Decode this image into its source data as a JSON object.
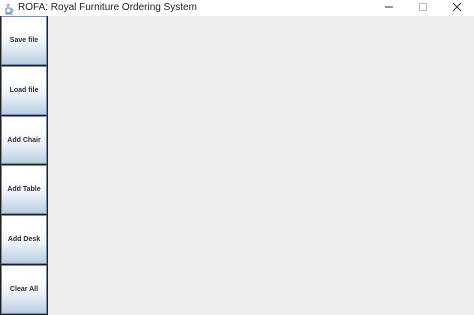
{
  "window": {
    "title": "ROFA: Royal Furniture Ordering System"
  },
  "toolbar": {
    "buttons": [
      {
        "label": "Save file"
      },
      {
        "label": "Load file"
      },
      {
        "label": "Add Chair"
      },
      {
        "label": "Add Table"
      },
      {
        "label": "Add Desk"
      },
      {
        "label": "Clear All"
      }
    ]
  },
  "icons": {
    "app": "java-cup-icon",
    "minimize": "minimize-icon",
    "maximize": "maximize-icon",
    "close": "close-icon"
  }
}
